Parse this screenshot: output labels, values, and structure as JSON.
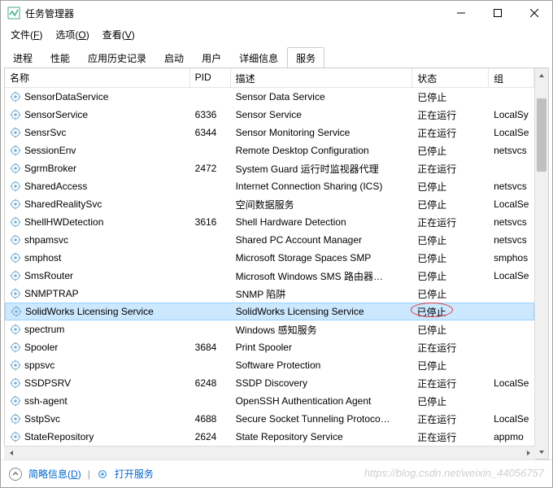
{
  "window": {
    "title": "任务管理器"
  },
  "menubar": [
    {
      "label": "文件",
      "key": "F"
    },
    {
      "label": "选项",
      "key": "O"
    },
    {
      "label": "查看",
      "key": "V"
    }
  ],
  "tabs": [
    "进程",
    "性能",
    "应用历史记录",
    "启动",
    "用户",
    "详细信息",
    "服务"
  ],
  "active_tab": 6,
  "columns": {
    "name": "名称",
    "pid": "PID",
    "desc": "描述",
    "status": "状态",
    "group": "组"
  },
  "status_stopped": "已停止",
  "status_running": "正在运行",
  "rows": [
    {
      "name": "SensorDataService",
      "pid": "",
      "desc": "Sensor Data Service",
      "status": "已停止",
      "group": ""
    },
    {
      "name": "SensorService",
      "pid": "6336",
      "desc": "Sensor Service",
      "status": "正在运行",
      "group": "LocalSy"
    },
    {
      "name": "SensrSvc",
      "pid": "6344",
      "desc": "Sensor Monitoring Service",
      "status": "正在运行",
      "group": "LocalSe"
    },
    {
      "name": "SessionEnv",
      "pid": "",
      "desc": "Remote Desktop Configuration",
      "status": "已停止",
      "group": "netsvcs"
    },
    {
      "name": "SgrmBroker",
      "pid": "2472",
      "desc": "System Guard 运行时监视器代理",
      "status": "正在运行",
      "group": ""
    },
    {
      "name": "SharedAccess",
      "pid": "",
      "desc": "Internet Connection Sharing (ICS)",
      "status": "已停止",
      "group": "netsvcs"
    },
    {
      "name": "SharedRealitySvc",
      "pid": "",
      "desc": "空间数据服务",
      "status": "已停止",
      "group": "LocalSe"
    },
    {
      "name": "ShellHWDetection",
      "pid": "3616",
      "desc": "Shell Hardware Detection",
      "status": "正在运行",
      "group": "netsvcs"
    },
    {
      "name": "shpamsvc",
      "pid": "",
      "desc": "Shared PC Account Manager",
      "status": "已停止",
      "group": "netsvcs"
    },
    {
      "name": "smphost",
      "pid": "",
      "desc": "Microsoft Storage Spaces SMP",
      "status": "已停止",
      "group": "smphos"
    },
    {
      "name": "SmsRouter",
      "pid": "",
      "desc": "Microsoft Windows SMS 路由器…",
      "status": "已停止",
      "group": "LocalSe"
    },
    {
      "name": "SNMPTRAP",
      "pid": "",
      "desc": "SNMP 陷阱",
      "status": "已停止",
      "group": ""
    },
    {
      "name": "SolidWorks Licensing Service",
      "pid": "",
      "desc": "SolidWorks Licensing Service",
      "status": "已停止",
      "group": "",
      "selected": true
    },
    {
      "name": "spectrum",
      "pid": "",
      "desc": "Windows 感知服务",
      "status": "已停止",
      "group": ""
    },
    {
      "name": "Spooler",
      "pid": "3684",
      "desc": "Print Spooler",
      "status": "正在运行",
      "group": ""
    },
    {
      "name": "sppsvc",
      "pid": "",
      "desc": "Software Protection",
      "status": "已停止",
      "group": ""
    },
    {
      "name": "SSDPSRV",
      "pid": "6248",
      "desc": "SSDP Discovery",
      "status": "正在运行",
      "group": "LocalSe"
    },
    {
      "name": "ssh-agent",
      "pid": "",
      "desc": "OpenSSH Authentication Agent",
      "status": "已停止",
      "group": ""
    },
    {
      "name": "SstpSvc",
      "pid": "4688",
      "desc": "Secure Socket Tunneling Protoco…",
      "status": "正在运行",
      "group": "LocalSe"
    },
    {
      "name": "StateRepository",
      "pid": "2624",
      "desc": "State Repository Service",
      "status": "正在运行",
      "group": "appmo"
    }
  ],
  "statusbar": {
    "fewer": "简略信息",
    "fewer_key": "D",
    "open": "打开服务"
  },
  "watermark": "https://blog.csdn.net/weixin_44056757"
}
